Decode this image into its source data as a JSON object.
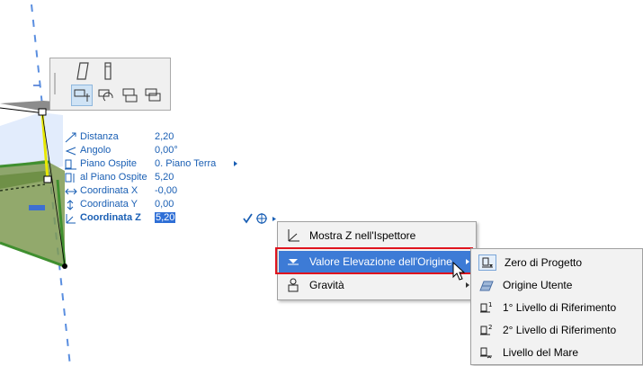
{
  "tracker": {
    "rows": [
      {
        "label": "Distanza",
        "value": "2,20"
      },
      {
        "label": "Angolo",
        "value": "0,00°"
      },
      {
        "label": "Piano Ospite",
        "value": "0. Piano Terra"
      },
      {
        "label": "al Piano Ospite",
        "value": "5,20"
      },
      {
        "label": "Coordinata X",
        "value": "-0,00"
      },
      {
        "label": "Coordinata Y",
        "value": "0,00"
      },
      {
        "label": "Coordinata Z",
        "value": "5,20"
      }
    ]
  },
  "context_menu": {
    "items": [
      {
        "label": "Mostra Z nell'Ispettore",
        "icon": "z-axis-icon"
      },
      {
        "label": "Valore Elevazione dell'Origine",
        "icon": "origin-elevation-icon",
        "highlighted": true
      },
      {
        "label": "Gravità",
        "icon": "gravity-icon"
      }
    ]
  },
  "submenu": {
    "items": [
      {
        "label": "Zero di Progetto",
        "icon": "project-zero-icon"
      },
      {
        "label": "Origine Utente",
        "icon": "user-origin-icon"
      },
      {
        "label": "1° Livello di Riferimento",
        "icon": "reference-level-1-icon"
      },
      {
        "label": "2° Livello di Riferimento",
        "icon": "reference-level-2-icon"
      },
      {
        "label": "Livello del Mare",
        "icon": "sea-level-icon"
      }
    ]
  },
  "colors": {
    "tracker_text": "#1a5fb4",
    "highlight": "#3d7bd6",
    "callout": "#e0141e",
    "slab_green": "#6aa84f"
  }
}
